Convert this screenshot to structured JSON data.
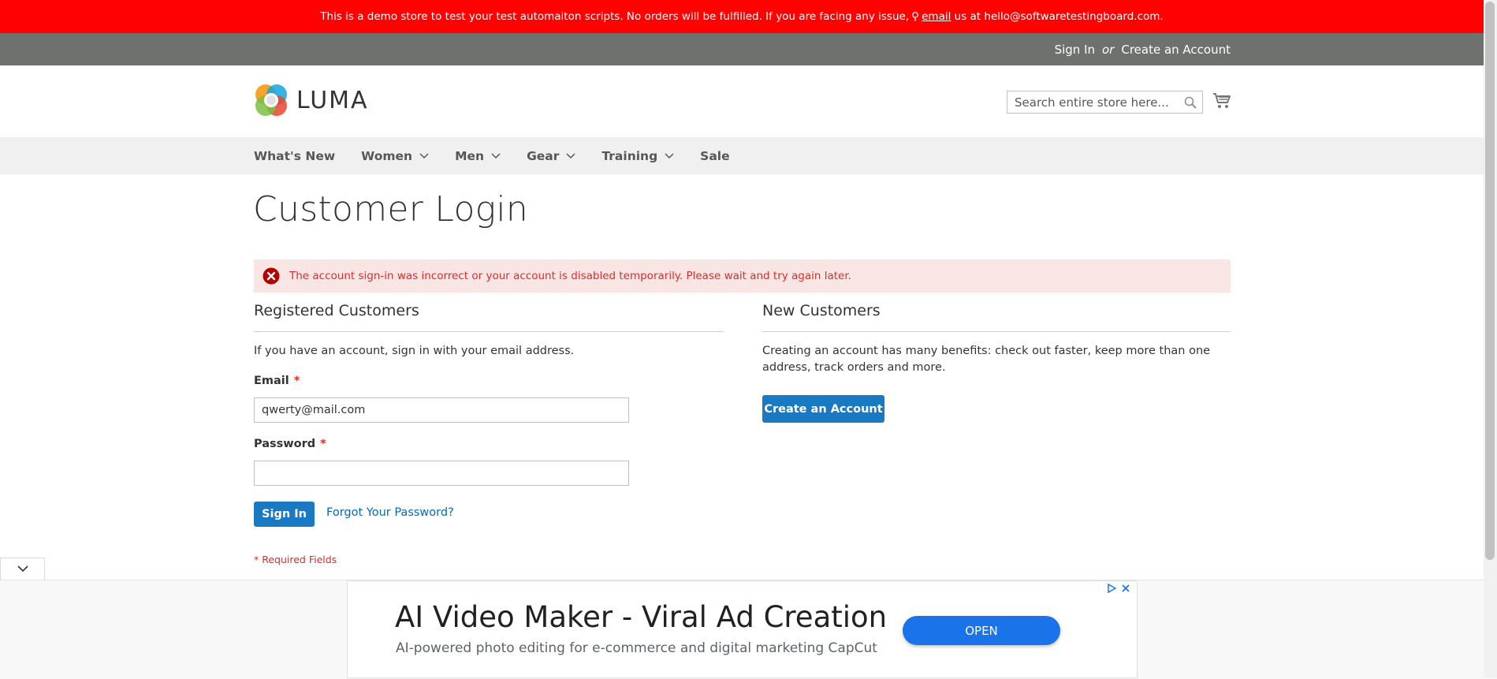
{
  "demo_notice": {
    "text_before": "This is a demo store to test your test automaiton scripts. No orders will be fulfilled. If you are facing any issue,",
    "key_glyph": "⚲",
    "link": "email",
    "text_after": "us at hello@softwaretestingboard.com."
  },
  "header_links": {
    "sign_in": "Sign In",
    "separator": "or",
    "create_account": "Create an Account"
  },
  "logo": {
    "text": "LUMA"
  },
  "search": {
    "placeholder": "Search entire store here..."
  },
  "nav": {
    "items": [
      {
        "label": "What's New",
        "has_dropdown": false
      },
      {
        "label": "Women",
        "has_dropdown": true
      },
      {
        "label": "Men",
        "has_dropdown": true
      },
      {
        "label": "Gear",
        "has_dropdown": true
      },
      {
        "label": "Training",
        "has_dropdown": true
      },
      {
        "label": "Sale",
        "has_dropdown": false
      }
    ]
  },
  "page": {
    "title": "Customer Login",
    "error_message": "The account sign-in was incorrect or your account is disabled temporarily. Please wait and try again later."
  },
  "registered": {
    "title": "Registered Customers",
    "intro": "If you have an account, sign in with your email address.",
    "email_label": "Email",
    "email_value": "qwerty@mail.com",
    "password_label": "Password",
    "password_value": "",
    "required_mark": "*",
    "sign_in_button": "Sign In",
    "forgot_link": "Forgot Your Password?",
    "required_note": "* Required Fields"
  },
  "new_customers": {
    "title": "New Customers",
    "text": "Creating an account has many benefits: check out faster, keep more than one address, track orders and more.",
    "button": "Create an Account"
  },
  "ad": {
    "title": "AI Video Maker - Viral Ad Creation",
    "subtitle": "AI-powered photo editing for e-commerce and digital marketing CapCut",
    "button": "OPEN"
  },
  "colors": {
    "demo_bar": "#ff0101",
    "panel_bar": "#6e716e",
    "primary_button": "#1979c3",
    "error_text": "#e02b27",
    "error_bg": "#fae5e5",
    "link": "#006bb4",
    "ad_button": "#1a73e8"
  },
  "icons": {
    "search": "magnifier-icon",
    "cart": "shopping-cart-icon",
    "error": "error-circle-x-icon",
    "dropdown": "chevron-down-icon",
    "ad_collapse": "chevron-down-icon",
    "ad_choices": "ad-choices-icon",
    "ad_close": "close-icon"
  }
}
